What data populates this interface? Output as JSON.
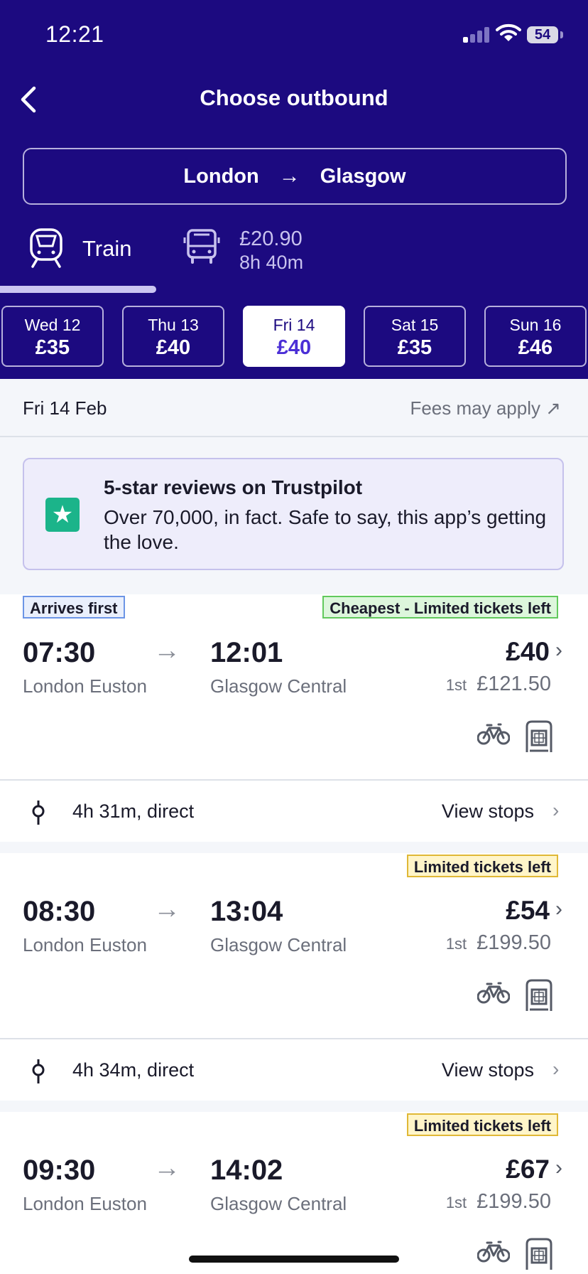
{
  "status": {
    "time": "12:21",
    "battery": "54"
  },
  "header": {
    "title": "Choose outbound",
    "route": {
      "from": "London",
      "arrow": "→",
      "to": "Glasgow"
    },
    "modes": {
      "train_label": "Train",
      "bus_price": "£20.90",
      "bus_duration": "8h 40m"
    },
    "days": [
      {
        "day": "Wed 12",
        "price": "£35"
      },
      {
        "day": "Thu 13",
        "price": "£40"
      },
      {
        "day": "Fri 14",
        "price": "£40"
      },
      {
        "day": "Sat 15",
        "price": "£35"
      },
      {
        "day": "Sun 16",
        "price": "£46"
      }
    ]
  },
  "date_bar": {
    "date": "Fri 14 Feb",
    "fees": "Fees may apply ↗"
  },
  "promo": {
    "title": "5-star reviews on Trustpilot",
    "text": "Over 70,000, in fact. Safe to say, this app’s getting the love."
  },
  "journeys": [
    {
      "tag_left": "Arrives first",
      "tag_right": "Cheapest - Limited tickets left",
      "depart": "07:30",
      "arrive": "12:01",
      "arrow": "→",
      "from": "London Euston",
      "to": "Glasgow Central",
      "price": "£40",
      "first_class_label": "1st",
      "first_class_price": "£121.50",
      "duration": "4h 31m, direct",
      "view_stops": "View stops"
    },
    {
      "tag_right": "Limited tickets left",
      "depart": "08:30",
      "arrive": "13:04",
      "arrow": "→",
      "from": "London Euston",
      "to": "Glasgow Central",
      "price": "£54",
      "first_class_label": "1st",
      "first_class_price": "£199.50",
      "duration": "4h 34m, direct",
      "view_stops": "View stops"
    },
    {
      "tag_right": "Limited tickets left",
      "depart": "09:30",
      "arrive": "14:02",
      "arrow": "→",
      "from": "London Euston",
      "to": "Glasgow Central",
      "price": "£67",
      "first_class_label": "1st",
      "first_class_price": "£199.50"
    }
  ],
  "icons": {
    "back": "chevron-left-icon",
    "train": "train-icon",
    "bus": "bus-icon",
    "star": "star-icon",
    "bike": "bicycle-icon",
    "seat": "seat-icon",
    "route": "route-icon",
    "chevron": "chevron-right-icon"
  },
  "colors": {
    "header_bg": "#1c0a80",
    "accent": "#4b2fd6",
    "promo_star": "#1bb48a"
  }
}
